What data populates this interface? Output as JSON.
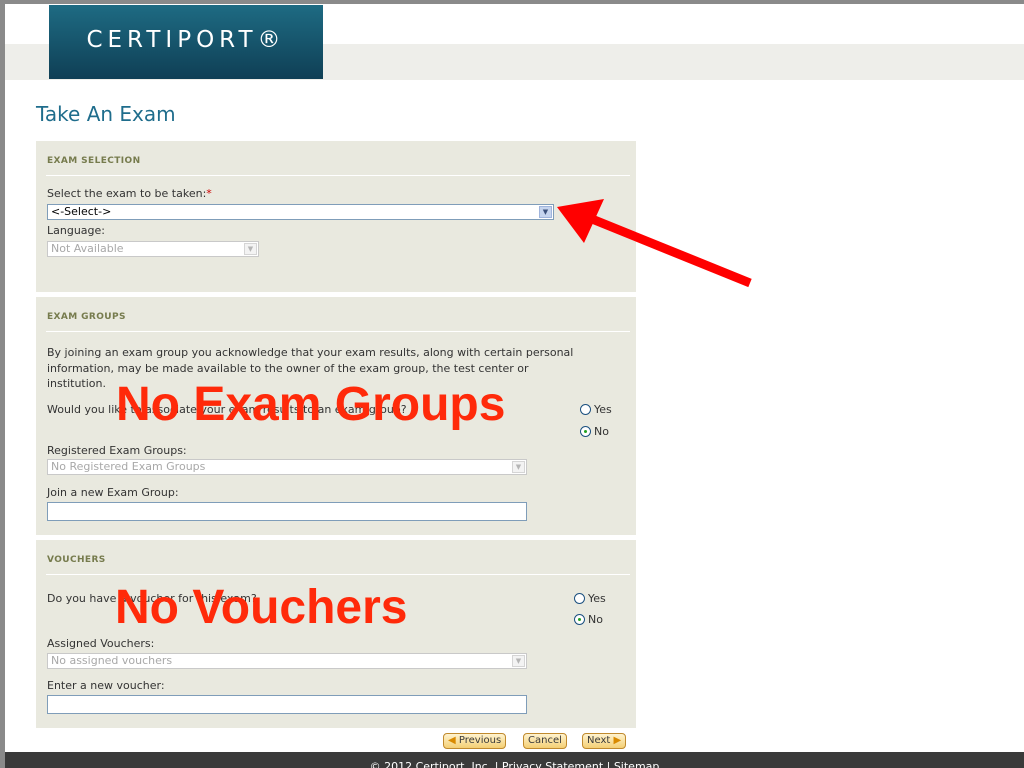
{
  "brand": {
    "logo_text": "CERTIPORT®"
  },
  "page": {
    "title": "Take An Exam"
  },
  "exam_selection": {
    "heading": "EXAM SELECTION",
    "exam_label": "Select the exam to be taken:",
    "required_mark": "*",
    "exam_value": "<-Select->",
    "language_label": "Language:",
    "language_value": "Not Available"
  },
  "exam_groups": {
    "heading": "EXAM GROUPS",
    "description": "By joining an exam group you acknowledge that your exam results, along with certain personal information, may be made available to the owner of the exam group, the test center or institution.",
    "question": "Would you like to associate your exam results to an exam group?",
    "yes_label": "Yes",
    "no_label": "No",
    "registered_label": "Registered Exam Groups:",
    "registered_value": "No Registered Exam Groups",
    "join_label": "Join a new Exam Group:",
    "overlay_text": "No Exam Groups"
  },
  "vouchers": {
    "heading": "VOUCHERS",
    "question": "Do you have a voucher for this exam?",
    "yes_label": "Yes",
    "no_label": "No",
    "assigned_label": "Assigned Vouchers:",
    "assigned_value": "No assigned vouchers",
    "enter_label": "Enter a new voucher:",
    "overlay_text": "No Vouchers"
  },
  "nav": {
    "previous": "Previous",
    "cancel": "Cancel",
    "next": "Next"
  },
  "footer": {
    "text": "© 2012 Certiport, Inc.   |   Privacy Statement   |   Sitemap"
  },
  "colors": {
    "overlay_red": "#ff2a0a",
    "arrow_red": "#ff0000",
    "panel_bg": "#e9e9df",
    "title_blue": "#1f6d8c"
  }
}
